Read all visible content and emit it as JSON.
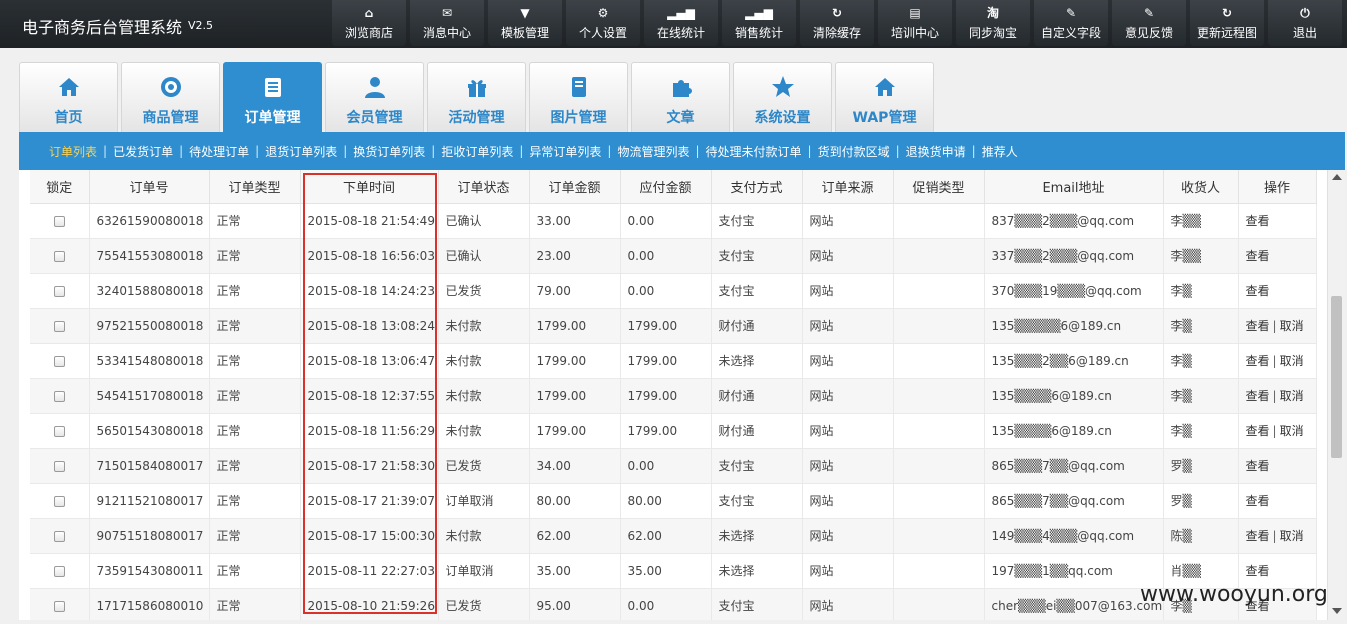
{
  "app": {
    "title": "电子商务后台管理系统",
    "version": "V2.5"
  },
  "topnav": [
    {
      "icon": "home-icon",
      "glyph": "⌂",
      "label": "浏览商店"
    },
    {
      "icon": "mail-icon",
      "glyph": "✉",
      "label": "消息中心"
    },
    {
      "icon": "shirt-icon",
      "glyph": "▼",
      "label": "模板管理"
    },
    {
      "icon": "gear-icon",
      "glyph": "⚙",
      "label": "个人设置"
    },
    {
      "icon": "signal-icon",
      "glyph": "▂▄▆",
      "label": "在线统计"
    },
    {
      "icon": "signal-icon",
      "glyph": "▂▄▆",
      "label": "销售统计"
    },
    {
      "icon": "refresh-icon",
      "glyph": "↻",
      "label": "清除缓存"
    },
    {
      "icon": "document-icon",
      "glyph": "▤",
      "label": "培训中心"
    },
    {
      "icon": "taobao-icon",
      "glyph": "淘",
      "label": "同步淘宝"
    },
    {
      "icon": "pencil-icon",
      "glyph": "✎",
      "label": "自定义字段"
    },
    {
      "icon": "pencil-icon",
      "glyph": "✎",
      "label": "意见反馈"
    },
    {
      "icon": "refresh-icon",
      "glyph": "↻",
      "label": "更新远程图"
    },
    {
      "icon": "power-icon",
      "glyph": "⏻",
      "label": "退出"
    }
  ],
  "tabs": [
    {
      "label": "首页",
      "icon": "home-icon"
    },
    {
      "label": "商品管理",
      "icon": "target-icon"
    },
    {
      "label": "订单管理",
      "icon": "notepad-icon",
      "active": true
    },
    {
      "label": "会员管理",
      "icon": "user-icon"
    },
    {
      "label": "活动管理",
      "icon": "gift-icon"
    },
    {
      "label": "图片管理",
      "icon": "book-icon"
    },
    {
      "label": "文章",
      "icon": "puzzle-icon"
    },
    {
      "label": "系统设置",
      "icon": "star-icon"
    },
    {
      "label": "WAP管理",
      "icon": "home-icon"
    }
  ],
  "subnav": [
    {
      "label": "订单列表",
      "active": true
    },
    {
      "label": "已发货订单"
    },
    {
      "label": "待处理订单"
    },
    {
      "label": "退货订单列表"
    },
    {
      "label": "换货订单列表"
    },
    {
      "label": "拒收订单列表"
    },
    {
      "label": "异常订单列表"
    },
    {
      "label": "物流管理列表"
    },
    {
      "label": "待处理未付款订单"
    },
    {
      "label": "货到付款区域"
    },
    {
      "label": "退换货申请"
    },
    {
      "label": "推荐人"
    }
  ],
  "table": {
    "columns": [
      "锁定",
      "订单号",
      "订单类型",
      "下单时间",
      "订单状态",
      "订单金额",
      "应付金额",
      "支付方式",
      "订单来源",
      "促销类型",
      "Email地址",
      "收货人",
      "操作"
    ],
    "rows": [
      {
        "id": "63261590080018",
        "type": "正常",
        "time": "2015-08-18 21:54:49",
        "status": "已确认",
        "amount": "33.00",
        "due": "0.00",
        "pay": "支付宝",
        "source": "网站",
        "promo": "",
        "email": "837▒▒▒2▒▒▒@qq.com",
        "receiver": "李▒▒",
        "actions": [
          "查看"
        ]
      },
      {
        "id": "75541553080018",
        "type": "正常",
        "time": "2015-08-18 16:56:03",
        "status": "已确认",
        "amount": "23.00",
        "due": "0.00",
        "pay": "支付宝",
        "source": "网站",
        "promo": "",
        "email": "337▒▒▒2▒▒▒@qq.com",
        "receiver": "李▒▒",
        "actions": [
          "查看"
        ]
      },
      {
        "id": "32401588080018",
        "type": "正常",
        "time": "2015-08-18 14:24:23",
        "status": "已发货",
        "amount": "79.00",
        "due": "0.00",
        "pay": "支付宝",
        "source": "网站",
        "promo": "",
        "email": "370▒▒▒19▒▒▒@qq.com",
        "receiver": "李▒",
        "actions": [
          "查看"
        ]
      },
      {
        "id": "97521550080018",
        "type": "正常",
        "time": "2015-08-18 13:08:24",
        "status": "未付款",
        "amount": "1799.00",
        "due": "1799.00",
        "pay": "财付通",
        "source": "网站",
        "promo": "",
        "email": "135▒▒▒▒▒6@189.cn",
        "receiver": "李▒",
        "actions": [
          "查看",
          "取消"
        ]
      },
      {
        "id": "53341548080018",
        "type": "正常",
        "time": "2015-08-18 13:06:47",
        "status": "未付款",
        "amount": "1799.00",
        "due": "1799.00",
        "pay": "未选择",
        "source": "网站",
        "promo": "",
        "email": "135▒▒▒2▒▒6@189.cn",
        "receiver": "李▒",
        "actions": [
          "查看",
          "取消"
        ]
      },
      {
        "id": "54541517080018",
        "type": "正常",
        "time": "2015-08-18 12:37:55",
        "status": "未付款",
        "amount": "1799.00",
        "due": "1799.00",
        "pay": "财付通",
        "source": "网站",
        "promo": "",
        "email": "135▒▒▒▒6@189.cn",
        "receiver": "李▒",
        "actions": [
          "查看",
          "取消"
        ]
      },
      {
        "id": "56501543080018",
        "type": "正常",
        "time": "2015-08-18 11:56:29",
        "status": "未付款",
        "amount": "1799.00",
        "due": "1799.00",
        "pay": "财付通",
        "source": "网站",
        "promo": "",
        "email": "135▒▒▒▒6@189.cn",
        "receiver": "李▒",
        "actions": [
          "查看",
          "取消"
        ]
      },
      {
        "id": "71501584080017",
        "type": "正常",
        "time": "2015-08-17 21:58:30",
        "status": "已发货",
        "amount": "34.00",
        "due": "0.00",
        "pay": "支付宝",
        "source": "网站",
        "promo": "",
        "email": "865▒▒▒7▒▒@qq.com",
        "receiver": "罗▒",
        "actions": [
          "查看"
        ]
      },
      {
        "id": "91211521080017",
        "type": "正常",
        "time": "2015-08-17 21:39:07",
        "status": "订单取消",
        "amount": "80.00",
        "due": "80.00",
        "pay": "支付宝",
        "source": "网站",
        "promo": "",
        "email": "865▒▒▒7▒▒@qq.com",
        "receiver": "罗▒",
        "actions": [
          "查看"
        ]
      },
      {
        "id": "90751518080017",
        "type": "正常",
        "time": "2015-08-17 15:00:30",
        "status": "未付款",
        "amount": "62.00",
        "due": "62.00",
        "pay": "未选择",
        "source": "网站",
        "promo": "",
        "email": "149▒▒▒4▒▒▒@qq.com",
        "receiver": "陈▒",
        "actions": [
          "查看",
          "取消"
        ]
      },
      {
        "id": "73591543080011",
        "type": "正常",
        "time": "2015-08-11 22:27:03",
        "status": "订单取消",
        "amount": "35.00",
        "due": "35.00",
        "pay": "未选择",
        "source": "网站",
        "promo": "",
        "email": "197▒▒▒1▒▒qq.com",
        "receiver": "肖▒▒",
        "actions": [
          "查看"
        ]
      },
      {
        "id": "17171586080010",
        "type": "正常",
        "time": "2015-08-10 21:59:26",
        "status": "已发货",
        "amount": "95.00",
        "due": "0.00",
        "pay": "支付宝",
        "source": "网站",
        "promo": "",
        "email": "cher▒▒▒ei▒▒007@163.com",
        "receiver": "李▒",
        "actions": [
          "查看"
        ]
      }
    ]
  },
  "watermark": "www.wooyun.org"
}
